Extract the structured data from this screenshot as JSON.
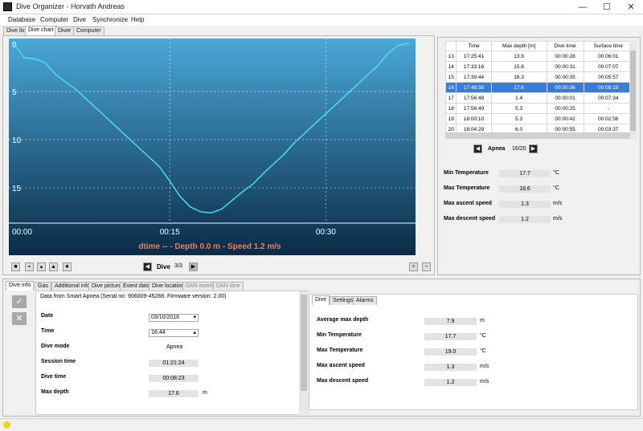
{
  "window": {
    "title": "Dive Organizer - Horvath Andreas",
    "minimize": "—",
    "maximize": "☐",
    "close": "✕"
  },
  "menu": [
    "Database",
    "Computer",
    "Dive",
    "Synchronize",
    "Help"
  ],
  "main_tabs": [
    "Dive list",
    "Dive chart",
    "Diver",
    "Computer"
  ],
  "chart": {
    "y_ticks": [
      "0",
      "5",
      "10",
      "15"
    ],
    "x_ticks": [
      "00:00",
      "00:15",
      "00:30"
    ],
    "caption": "dtime -- - Depth 0.0 m - Speed 1.2 m/s"
  },
  "chart_data": {
    "type": "line",
    "title": "",
    "xlabel": "",
    "ylabel": "",
    "x_unit": "seconds",
    "y_inverted": true,
    "ylim": [
      0,
      18
    ],
    "xlim": [
      0,
      38
    ],
    "grid": true,
    "x": [
      0,
      1,
      2,
      3,
      4,
      5,
      6,
      7,
      8,
      9,
      10,
      11,
      12,
      13,
      14,
      15,
      16,
      17,
      18,
      19,
      20,
      21,
      22,
      23,
      24,
      25,
      26,
      27,
      28,
      29,
      30,
      31,
      32,
      33,
      34,
      35,
      36,
      37,
      38
    ],
    "y": [
      0.0,
      1.5,
      1.6,
      2.0,
      3.2,
      4.0,
      4.8,
      5.8,
      6.8,
      7.8,
      8.8,
      9.8,
      10.8,
      11.8,
      12.8,
      14.3,
      15.9,
      17.0,
      17.5,
      17.6,
      17.2,
      16.3,
      15.4,
      14.6,
      13.5,
      12.5,
      11.5,
      10.3,
      9.3,
      8.3,
      7.3,
      6.3,
      5.3,
      4.3,
      3.3,
      2.3,
      1.0,
      0.2,
      0.0
    ]
  },
  "chart_toolbar": {
    "dive_label": "Dive",
    "dive_page": "3/3",
    "zoom_in": "+",
    "zoom_out": "−",
    "prev": "◀",
    "next": "▶"
  },
  "dive_table": {
    "headers": [
      "",
      "Time",
      "Max depth [m]",
      "Dive time",
      "Surface time"
    ],
    "rows": [
      [
        "13",
        "17:25:41",
        "13.9",
        "00:00:28",
        "00:06:01"
      ],
      [
        "14",
        "17:33:16",
        "15.8",
        "00:00:31",
        "00:07:07"
      ],
      [
        "15",
        "17:39:44",
        "16.3",
        "00:00:35",
        "00:05:57"
      ],
      [
        "16",
        "17:48:38",
        "17.6",
        "00:00:36",
        "00:08:19"
      ],
      [
        "17",
        "17:56:48",
        "1.4",
        "00:00:01",
        "00:07:34"
      ],
      [
        "18",
        "17:56:49",
        "5.3",
        "00:00:25",
        "-"
      ],
      [
        "19",
        "18:00:10",
        "5.3",
        "00:00:42",
        "00:02:56"
      ],
      [
        "20",
        "18:04:29",
        "6.0",
        "00:00:55",
        "00:03:37"
      ]
    ],
    "selected_index": 3
  },
  "apnea_nav": {
    "label": "Apnea",
    "page": "16/20",
    "prev": "◀",
    "next": "▶"
  },
  "stats_right": [
    {
      "label": "Min Temperature",
      "value": "17.7",
      "unit": "°C"
    },
    {
      "label": "Max Temperature",
      "value": "18.6",
      "unit": "°C"
    },
    {
      "label": "Max ascent speed",
      "value": "1.3",
      "unit": "m/s"
    },
    {
      "label": "Max descent speed",
      "value": "1.2",
      "unit": "m/s"
    }
  ],
  "bottom_tabs": [
    "Dive info",
    "Gas",
    "Additional info",
    "Dive picture",
    "Event data",
    "Dive location",
    "DAN event",
    "DAN dive"
  ],
  "dive_info": {
    "source": "Data from Smart Apnea (Serial no: 906009-45288. Firmware version: 2.00)",
    "date_label": "Date",
    "date_value": "03/10/2016",
    "time_label": "Time",
    "time_value": "16:44",
    "mode_label": "Dive mode",
    "mode_value": "Apnea",
    "session_label": "Session time",
    "session_value": "01:21:24",
    "divetime_label": "Dive time",
    "divetime_value": "00:08:23",
    "maxdepth_label": "Max depth",
    "maxdepth_value": "17.6",
    "maxdepth_unit": "m"
  },
  "sub_tabs": [
    "Dive",
    "Settings",
    "Alarms"
  ],
  "dive_stats": [
    {
      "label": "Average max depth",
      "value": "7.9",
      "unit": "m"
    },
    {
      "label": "Min Temperature",
      "value": "17.7",
      "unit": "°C"
    },
    {
      "label": "Max Temperature",
      "value": "19.0",
      "unit": "°C"
    },
    {
      "label": "Max ascent speed",
      "value": "1.3",
      "unit": "m/s"
    },
    {
      "label": "Max descent speed",
      "value": "1.2",
      "unit": "m/s"
    }
  ],
  "colors": {
    "chart_bg_top": "#4aa8d8",
    "chart_bg_bottom": "#0a2b46",
    "line": "#4fe3f0",
    "caption": "#ff7a4a",
    "selection": "#3a7bd5"
  }
}
